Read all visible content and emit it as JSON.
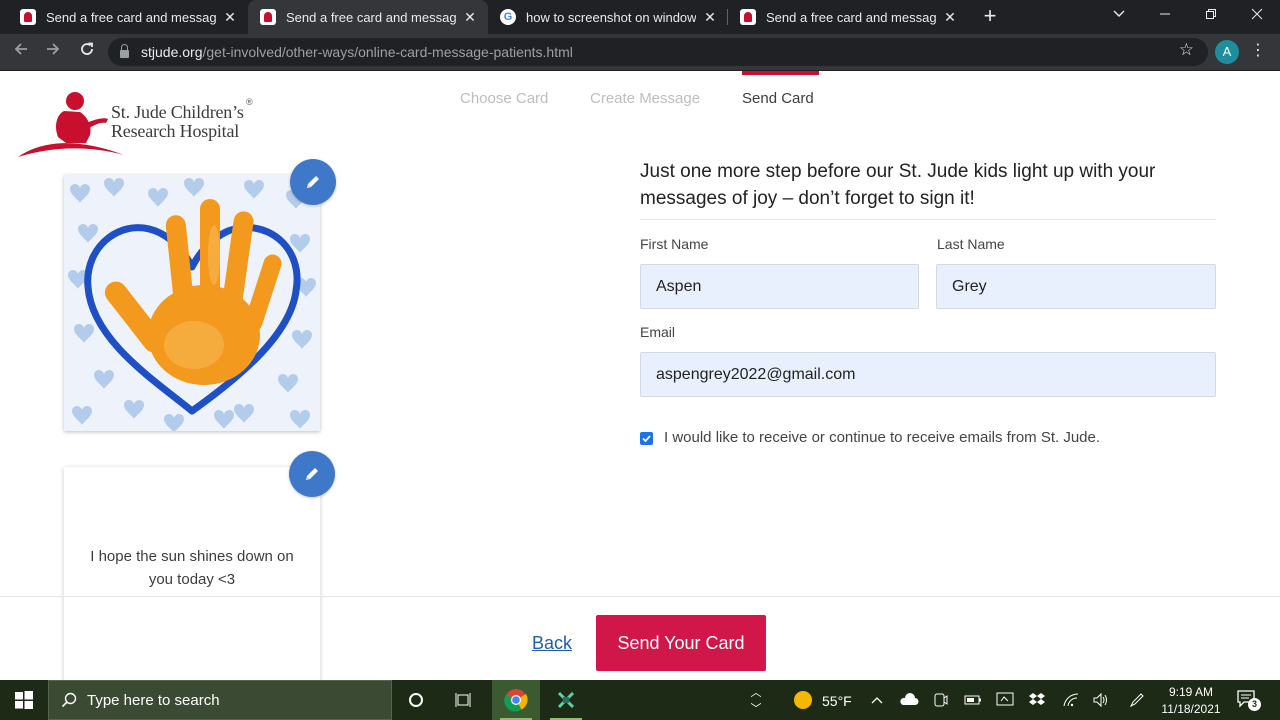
{
  "browser": {
    "tabs": [
      {
        "title": "Send a free card and message to",
        "favicon": "stjude-favicon",
        "active": false
      },
      {
        "title": "Send a free card and message to",
        "favicon": "stjude-favicon",
        "active": true
      },
      {
        "title": "how to screenshot on windows -",
        "favicon": "google-favicon",
        "active": false
      },
      {
        "title": "Send a free card and message to",
        "favicon": "stjude-favicon",
        "active": false
      }
    ],
    "close_glyph": "✕",
    "new_tab_glyph": "+",
    "url_host": "stjude.org",
    "url_path": "/get-involved/other-ways/online-card-message-patients.html",
    "profile_initial": "A"
  },
  "page": {
    "logo": {
      "line1": "St. Jude Children’s",
      "line2": "Research Hospital",
      "reg": "®",
      "color": "#c8102e"
    },
    "steps": [
      {
        "label": "Choose Card",
        "active": false
      },
      {
        "label": "Create Message",
        "active": false
      },
      {
        "label": "Send Card",
        "active": true
      }
    ],
    "card_message": "I hope the sun shines down on you today <3",
    "intro": "Just one more step before our St. Jude kids light up with your messages of joy – don’t forget to sign it!",
    "form": {
      "first_name_label": "First Name",
      "first_name_value": "Aspen",
      "last_name_label": "Last Name",
      "last_name_value": "Grey",
      "email_label": "Email",
      "email_value": "aspengrey2022@gmail.com",
      "opt_in_checked": true,
      "opt_in_label": "I would like to receive or continue to receive emails from St. Jude."
    },
    "back_label": "Back",
    "send_label": "Send Your Card",
    "accent_color": "#d1164a"
  },
  "taskbar": {
    "search_placeholder": "Type here to search",
    "weather": "55°F",
    "time": "9:19 AM",
    "date": "11/18/2021",
    "notification_count": "3"
  }
}
